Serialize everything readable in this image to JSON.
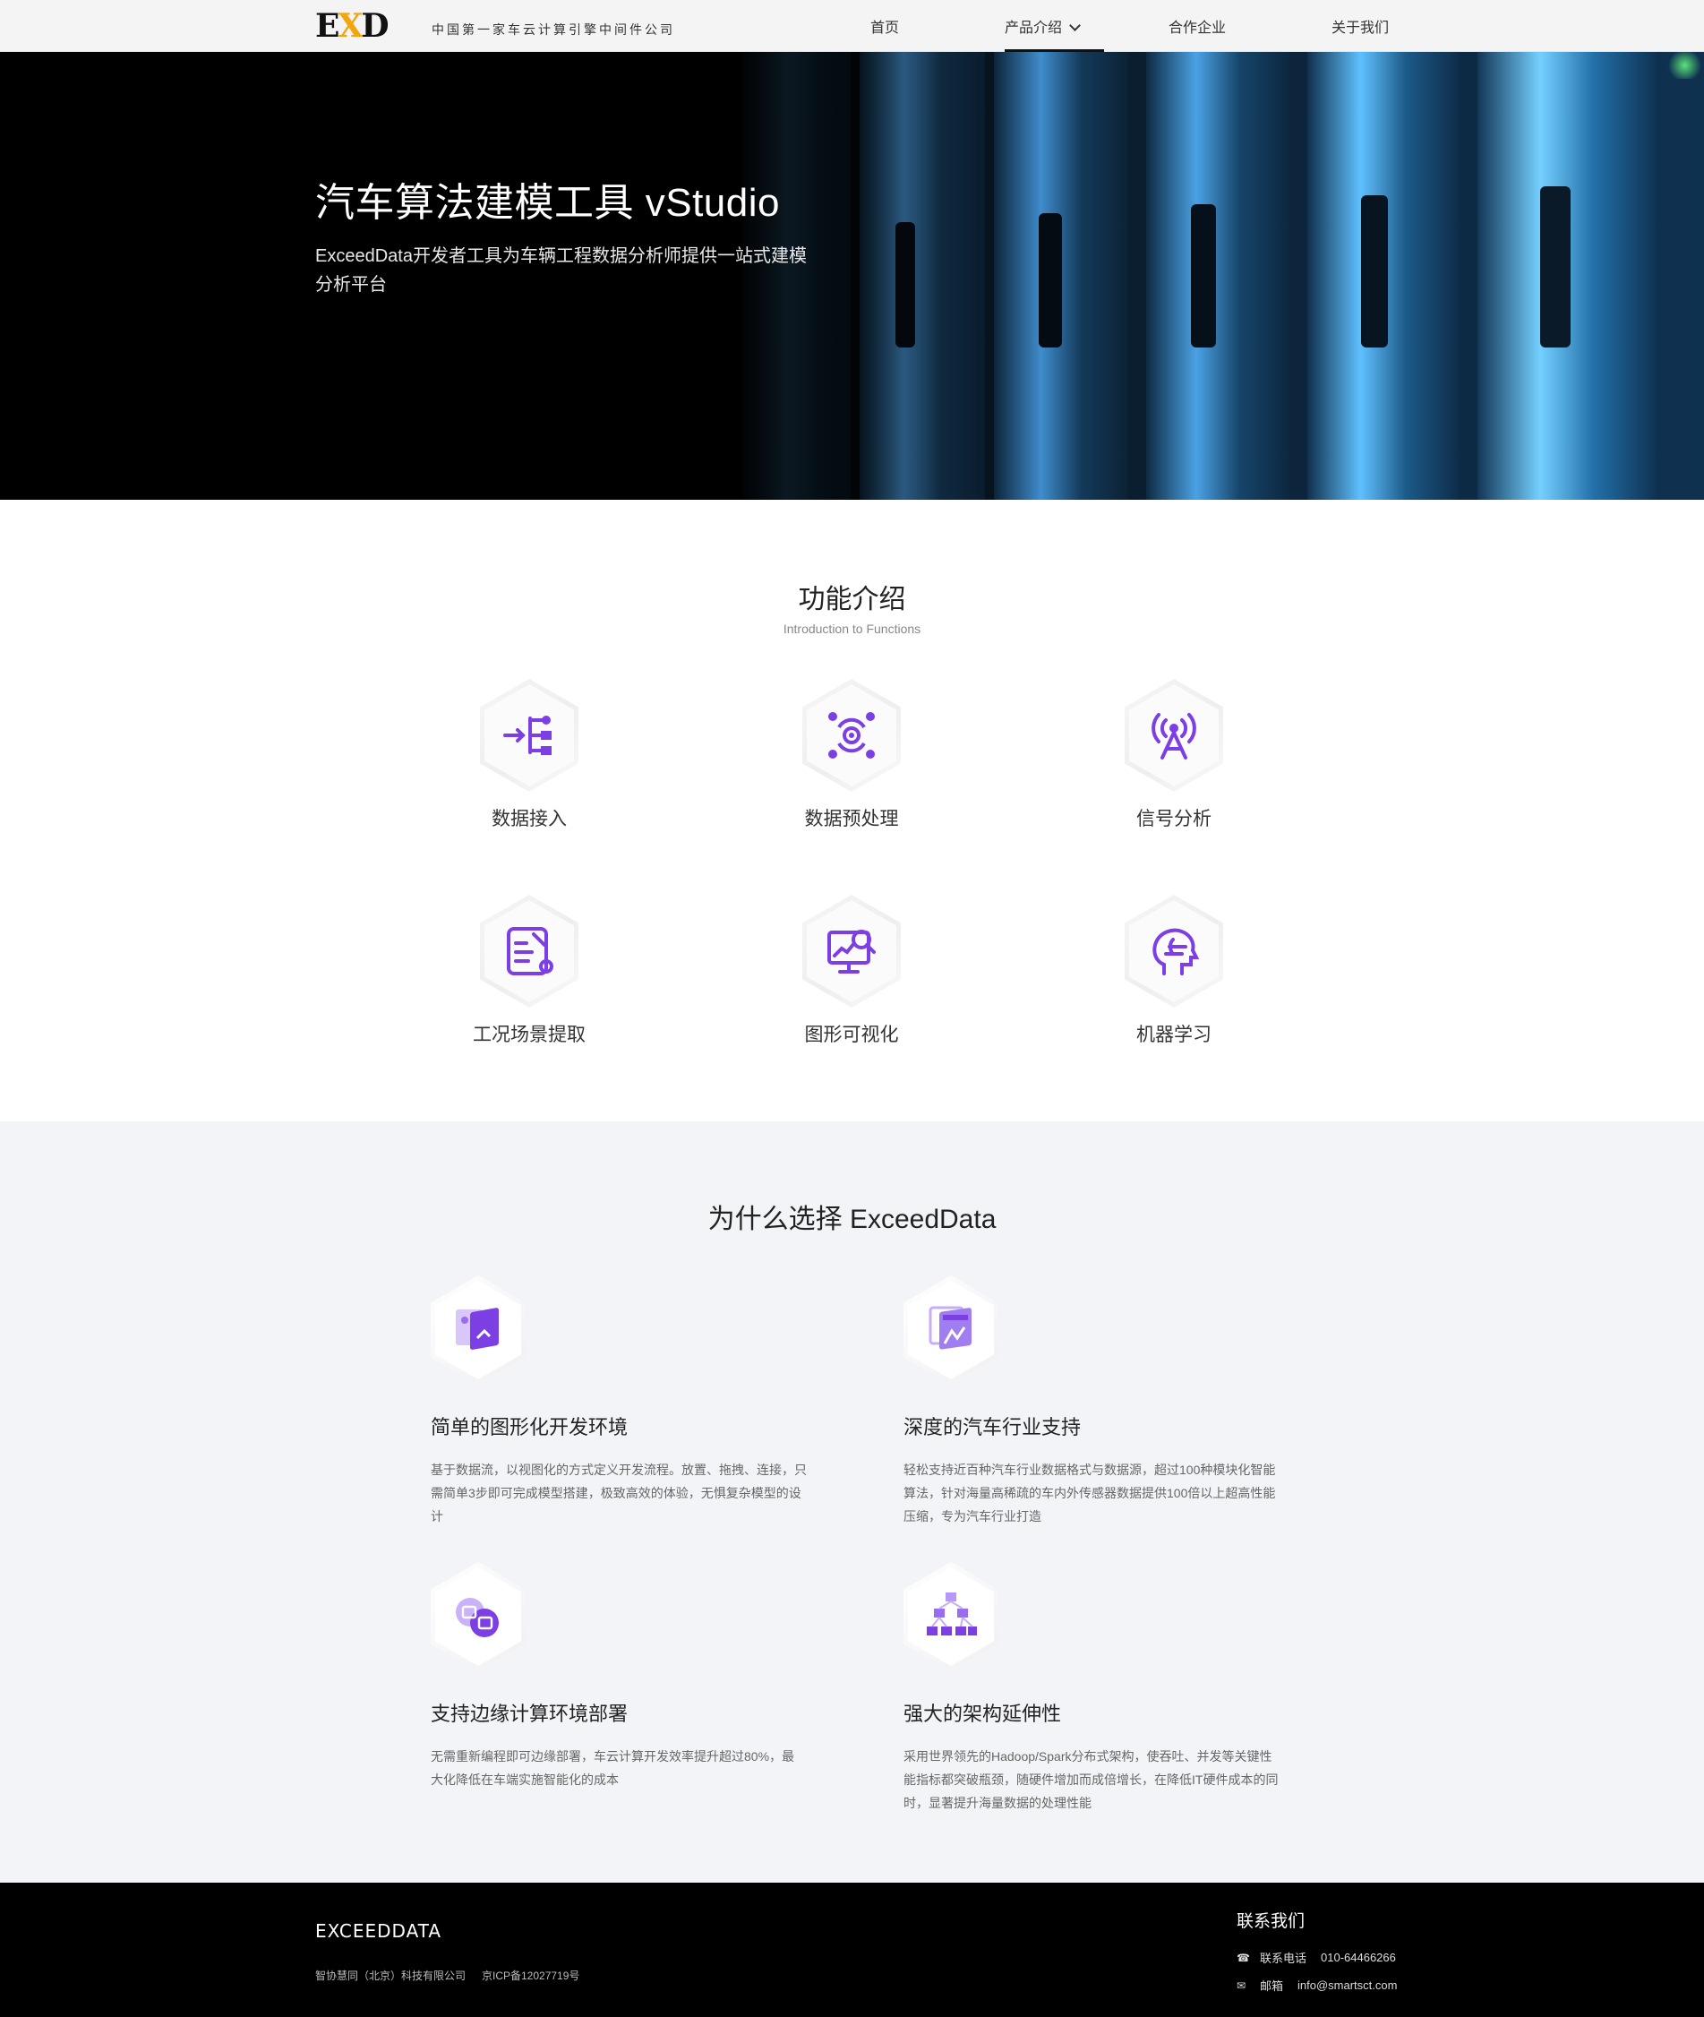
{
  "header": {
    "logo": {
      "part1": "E",
      "part2": "X",
      "part3": "D"
    },
    "tagline": "中国第一家车云计算引擎中间件公司",
    "nav": [
      {
        "label": "首页"
      },
      {
        "label": "产品介绍"
      },
      {
        "label": "合作企业"
      },
      {
        "label": "关于我们"
      }
    ]
  },
  "hero": {
    "title": "汽车算法建模工具 vStudio",
    "subtitle": "ExceedData开发者工具为车辆工程数据分析师提供一站式建模分析平台"
  },
  "functions": {
    "title": "功能介绍",
    "subtitle": "Introduction to Functions",
    "items": [
      {
        "label": "数据接入",
        "icon": "data-ingest-icon"
      },
      {
        "label": "数据预处理",
        "icon": "data-preprocess-icon"
      },
      {
        "label": "信号分析",
        "icon": "signal-tower-icon"
      },
      {
        "label": "工况场景提取",
        "icon": "scenario-extract-icon"
      },
      {
        "label": "图形可视化",
        "icon": "visualization-icon"
      },
      {
        "label": "机器学习",
        "icon": "machine-learning-icon"
      }
    ]
  },
  "why": {
    "title": "为什么选择 ExceedData",
    "items": [
      {
        "title": "简单的图形化开发环境",
        "desc": "基于数据流，以视图化的方式定义开发流程。放置、拖拽、连接，只需简单3步即可完成模型搭建，极致高效的体验，无惧复杂模型的设计",
        "icon": "graphical-dev-icon"
      },
      {
        "title": "深度的汽车行业支持",
        "desc": "轻松支持近百种汽车行业数据格式与数据源，超过100种模块化智能算法，针对海量高稀疏的车内外传感器数据提供100倍以上超高性能压缩，专为汽车行业打造",
        "icon": "industry-support-icon"
      },
      {
        "title": "支持边缘计算环境部署",
        "desc": "无需重新编程即可边缘部署，车云计算开发效率提升超过80%，最大化降低在车端实施智能化的成本",
        "icon": "edge-compute-icon"
      },
      {
        "title": "强大的架构延伸性",
        "desc": "采用世界领先的Hadoop/Spark分布式架构，使吞吐、并发等关键性能指标都突破瓶颈，随硬件增加而成倍增长，在降低IT硬件成本的同时，显著提升海量数据的处理性能",
        "icon": "architecture-icon"
      }
    ]
  },
  "footer": {
    "logo": "EXCEEDDATA",
    "company": "智协慧同（北京）科技有限公司",
    "icp": "京ICP备12027719号",
    "contact_title": "联系我们",
    "phone_label": "联系电话",
    "phone": "010-64466266",
    "email_label": "邮箱",
    "email": "info@smartsct.com"
  },
  "colors": {
    "accent": "#7b3fe4",
    "logo_x": "#f2a60c",
    "hero_blue": "#2a9fe0"
  }
}
